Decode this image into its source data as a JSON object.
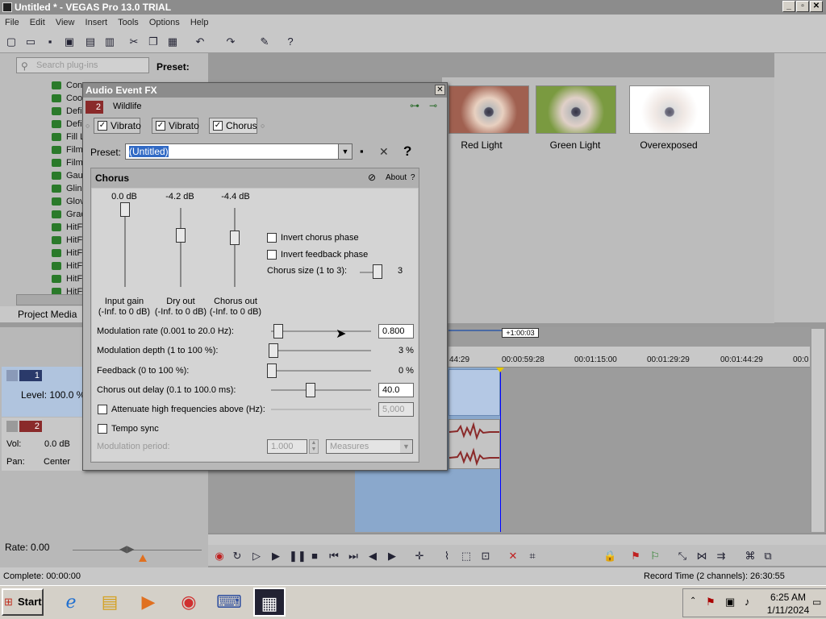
{
  "window": {
    "title": "Untitled * - VEGAS Pro 13.0 TRIAL"
  },
  "menu": [
    "File",
    "Edit",
    "View",
    "Insert",
    "Tools",
    "Options",
    "Help"
  ],
  "plugins": {
    "search_placeholder": "Search plug-ins",
    "preset_label": "Preset:",
    "tree_items": [
      "Con",
      "Coo",
      "Defi",
      "Defi",
      "Fill L",
      "Film",
      "Film",
      "Gau",
      "Glin",
      "Glov",
      "Grad",
      "HitF",
      "HitF",
      "HitF",
      "HitF",
      "HitF",
      "HitF"
    ],
    "tab": "Project Media"
  },
  "fx_previews": [
    {
      "label": "Red Light"
    },
    {
      "label": "Green Light"
    },
    {
      "label": "Overexposed"
    }
  ],
  "dialog": {
    "title": "Audio Event FX",
    "event_number": "2",
    "event_name": "Wildlife",
    "chain": [
      {
        "label": "Vibrato",
        "checked": true
      },
      {
        "label": "Vibrato",
        "checked": true
      },
      {
        "label": "Chorus",
        "checked": true
      }
    ],
    "preset_label": "Preset:",
    "preset_value": "(Untitled)",
    "panel_title": "Chorus",
    "about": "About",
    "help": "?",
    "faders": [
      {
        "db": "0.0 dB",
        "name": "Input gain",
        "range": "(-Inf. to 0 dB)"
      },
      {
        "db": "-4.2 dB",
        "name": "Dry out",
        "range": "(-Inf. to 0 dB)"
      },
      {
        "db": "-4.4 dB",
        "name": "Chorus out",
        "range": "(-Inf. to 0 dB)"
      }
    ],
    "invert_chorus": "Invert chorus phase",
    "invert_feedback": "Invert feedback phase",
    "chorus_size_label": "Chorus size (1 to 3):",
    "chorus_size_value": "3",
    "mod_rate_label": "Modulation rate (0.001 to 20.0 Hz):",
    "mod_rate_value": "0.800",
    "mod_depth_label": "Modulation depth (1 to 100 %):",
    "mod_depth_value": "3 %",
    "feedback_label": "Feedback (0 to 100 %):",
    "feedback_value": "0 %",
    "chorus_delay_label": "Chorus out delay (0.1 to 100.0 ms):",
    "chorus_delay_value": "40.0",
    "attenuate_label": "Attenuate high frequencies above (Hz):",
    "attenuate_value": "5,000",
    "tempo_sync": "Tempo sync",
    "mod_period_label": "Modulation period:",
    "mod_period_value": "1.000",
    "measures": "Measures"
  },
  "tracks": {
    "t1": {
      "number": "1",
      "level": "Level: 100.0 %"
    },
    "t2": {
      "number": "2",
      "vol_label": "Vol:",
      "vol": "0.0 dB",
      "pan_label": "Pan:",
      "pan": "Center"
    }
  },
  "timeline": {
    "duration": "+1:00:03",
    "ruler": [
      "44:29",
      "00:00:59:28",
      "00:01:15:00",
      "00:01:29:29",
      "00:01:44:29",
      "00:0"
    ]
  },
  "bottom": {
    "rate": "Rate: 0.00",
    "complete": "Complete: 00:00:00",
    "record_time": "Record Time (2 channels): 26:30:55"
  },
  "taskbar": {
    "start": "Start",
    "time": "6:25 AM",
    "date": "1/11/2024"
  }
}
